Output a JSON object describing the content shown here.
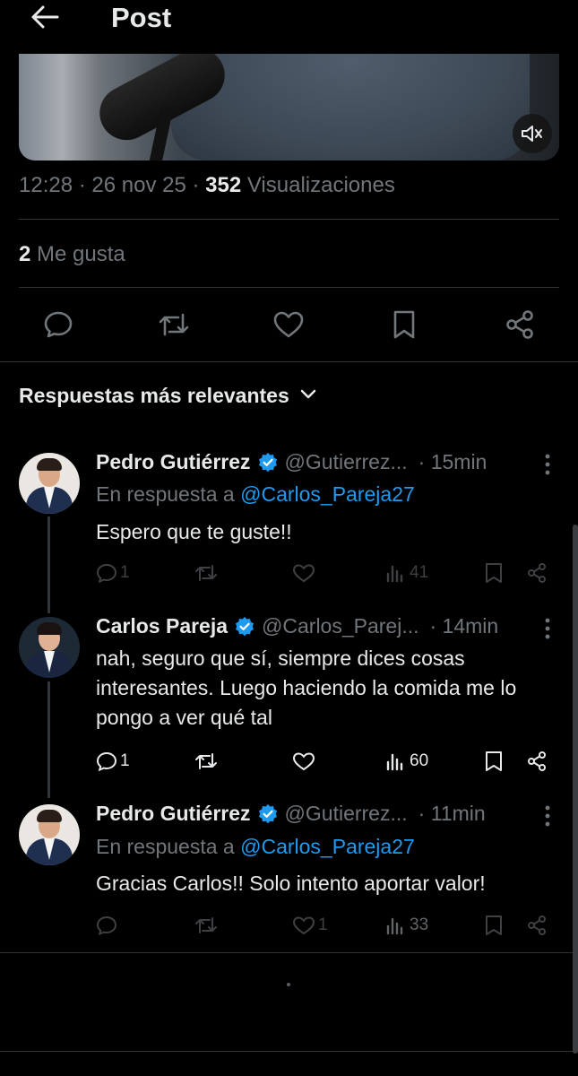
{
  "header": {
    "title": "Post"
  },
  "post": {
    "time": "12:28",
    "date": "26 nov 25",
    "views_count": "352",
    "views_label": "Visualizaciones",
    "likes_count": "2",
    "likes_label": "Me gusta",
    "media_icons": {
      "mute": "volume-muted-icon"
    }
  },
  "actions": [
    "reply-icon",
    "repost-icon",
    "like-icon",
    "bookmark-icon",
    "share-icon"
  ],
  "sort": {
    "label": "Respuestas más relevantes"
  },
  "replies": [
    {
      "name": "Pedro Gutiérrez",
      "handle": "@Gutierrez...",
      "time": "· 15min",
      "replying_prefix": "En respuesta a",
      "replying_to": "@Carlos_Pareja27",
      "text": "Espero que te guste!!",
      "reply_count": "1",
      "repost_count": "",
      "like_count": "",
      "views": "41"
    },
    {
      "name": "Carlos Pareja",
      "handle": "@Carlos_Parej...",
      "time": "· 14min",
      "text": "nah, seguro que sí, siempre dices cosas interesantes. Luego haciendo la comida me lo pongo a ver qué tal",
      "reply_count": "1",
      "repost_count": "",
      "like_count": "",
      "views": "60"
    },
    {
      "name": "Pedro Gutiérrez",
      "handle": "@Gutierrez...",
      "time": "· 11min",
      "replying_prefix": "En respuesta a",
      "replying_to": "@Carlos_Pareja27",
      "text": "Gracias Carlos!! Solo intento aportar valor!",
      "reply_count": "",
      "repost_count": "",
      "like_count": "1",
      "views": "33"
    }
  ],
  "colors": {
    "accent": "#1d9bf0",
    "muted": "#71767b",
    "text": "#e7e9ea",
    "background": "#000000"
  }
}
